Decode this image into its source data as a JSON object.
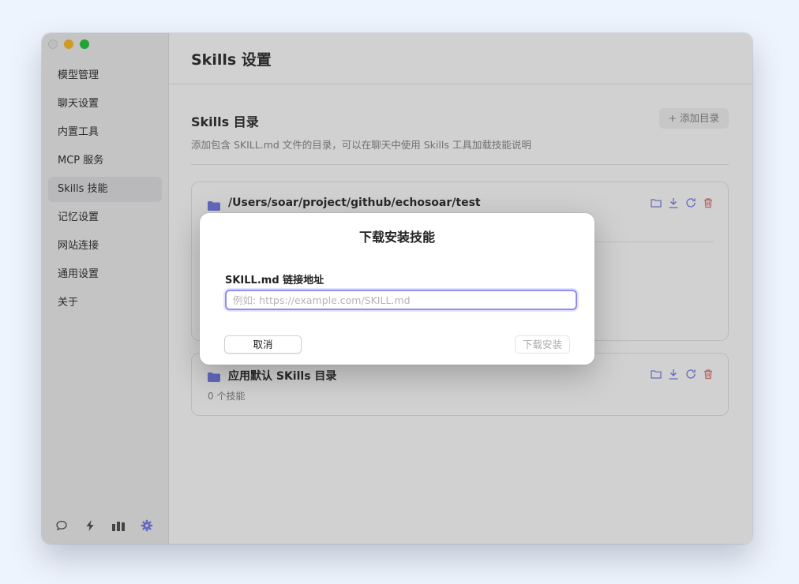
{
  "sidebar": {
    "items": [
      {
        "label": "模型管理"
      },
      {
        "label": "聊天设置"
      },
      {
        "label": "内置工具"
      },
      {
        "label": "MCP 服务"
      },
      {
        "label": "Skills 技能",
        "active": true
      },
      {
        "label": "记忆设置"
      },
      {
        "label": "网站连接"
      },
      {
        "label": "通用设置"
      },
      {
        "label": "关于"
      }
    ],
    "bottom_icons": [
      "chat-bubble-icon",
      "lightning-icon",
      "chart-bars-icon",
      "gear-icon"
    ]
  },
  "main": {
    "page_title": "Skills 设置",
    "section_title": "Skills 目录",
    "section_desc": "添加包含 SKILL.md 文件的目录，可以在聊天中使用 Skills 工具加载技能说明",
    "add_dir_label": "+ 添加目录",
    "directories": [
      {
        "path": "/Users/soar/project/github/echosoar/test",
        "count": ""
      },
      {
        "path": "应用默认 SKills 目录",
        "count": "0 个技能"
      }
    ]
  },
  "dialog": {
    "title": "下载安装技能",
    "field_label": "SKILL.md 链接地址",
    "input_value": "",
    "input_placeholder": "例如: https://example.com/SKILL.md",
    "cancel_label": "取消",
    "install_label": "下载安装"
  },
  "colors": {
    "accent": "#7b7fe8",
    "delete": "#e57373",
    "background": "#eef4fd"
  }
}
